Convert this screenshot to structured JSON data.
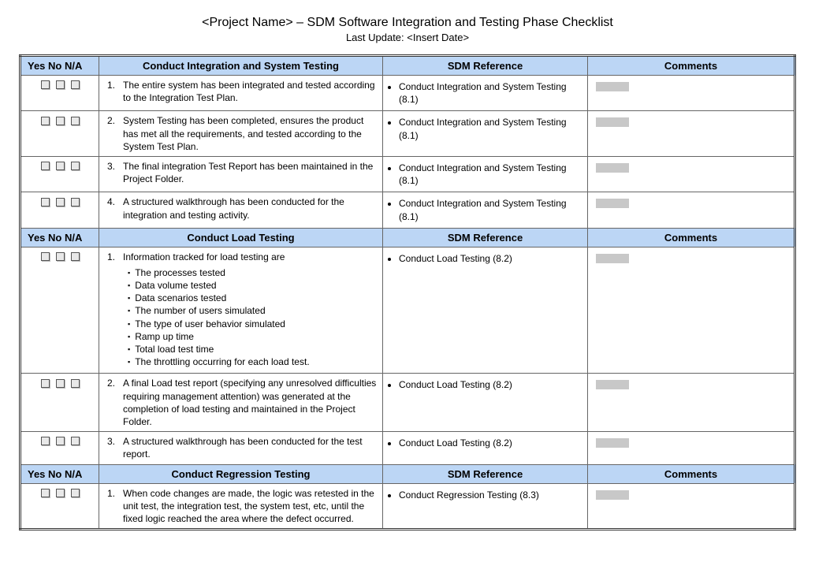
{
  "title": "<Project Name> – SDM Software Integration and Testing Phase Checklist",
  "subtitle": "Last Update: <Insert Date>",
  "columns": {
    "yn": "Yes No N/A",
    "task_prefix": "Conduct",
    "ref": "SDM Reference",
    "comments": "Comments"
  },
  "sections": [
    {
      "heading": "Conduct Integration and System Testing",
      "rows": [
        {
          "num": "1.",
          "text": "The entire system has been integrated and tested according to the Integration Test Plan.",
          "ref": "Conduct Integration and System Testing (8.1)"
        },
        {
          "num": "2.",
          "text": "System Testing has been completed, ensures the product has met all the requirements, and tested according to the System Test Plan.",
          "ref": "Conduct Integration and System Testing (8.1)"
        },
        {
          "num": "3.",
          "text": "The final integration Test Report has been maintained in the Project Folder.",
          "ref": "Conduct Integration and System Testing (8.1)"
        },
        {
          "num": "4.",
          "text": "A structured walkthrough has been conducted for the integration and testing activity.",
          "ref": "Conduct Integration and System Testing (8.1)"
        }
      ]
    },
    {
      "heading": "Conduct Load Testing",
      "rows": [
        {
          "num": "1.",
          "text": "Information tracked for load testing are",
          "sub": [
            "The processes tested",
            "Data volume tested",
            "Data scenarios tested",
            "The number of users simulated",
            "The type of user behavior simulated",
            "Ramp up time",
            "Total load test time",
            "The throttling occurring for each load test."
          ],
          "ref": "Conduct Load Testing (8.2)"
        },
        {
          "num": "2.",
          "text": "A final Load test report (specifying any unresolved difficulties requiring management attention) was generated at the completion of load testing and maintained in the Project Folder.",
          "ref": "Conduct Load Testing (8.2)"
        },
        {
          "num": "3.",
          "text": "A structured walkthrough has been conducted for the test report.",
          "ref": "Conduct Load Testing (8.2)"
        }
      ]
    },
    {
      "heading": "Conduct Regression Testing",
      "rows": [
        {
          "num": "1.",
          "text": "When code changes are made, the logic was retested in the unit test, the integration test, the system test, etc, until the fixed logic reached the area where the defect occurred.",
          "ref": "Conduct Regression Testing (8.3)"
        }
      ]
    }
  ]
}
